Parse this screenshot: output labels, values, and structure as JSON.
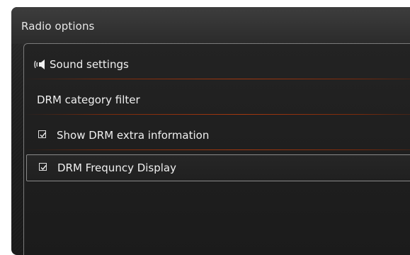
{
  "header": {
    "title": "Radio options"
  },
  "menu": {
    "items": [
      {
        "label": "Sound settings",
        "icon": "speaker-icon"
      },
      {
        "label": "DRM category filter"
      },
      {
        "label": "Show DRM extra information",
        "checked": true
      },
      {
        "label": "DRM Frequncy Display",
        "checked": true,
        "selected": true
      }
    ]
  },
  "colors": {
    "accent": "#a3380f",
    "selection_border": "#8a8a8a",
    "background": "#1f1f1f",
    "text": "#f0f0f0"
  }
}
